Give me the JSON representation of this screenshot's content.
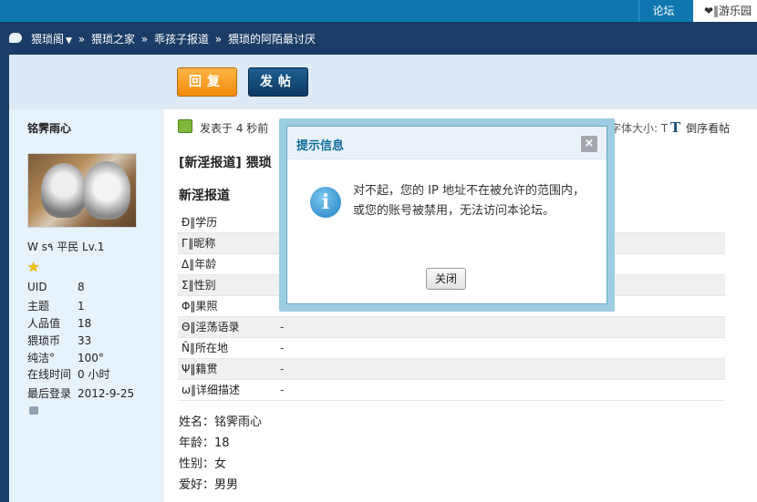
{
  "topbar": {
    "tab_forum": "论坛",
    "tab_playground": "❤‖游乐园"
  },
  "breadcrumb": {
    "items": [
      "猥琐阁",
      "猥琐之家",
      "乖孩子报道",
      "猥琐的阿陌最讨厌"
    ],
    "separator": "»"
  },
  "toolbar": {
    "reply_label": "回复",
    "post_label": "发帖"
  },
  "author": {
    "name": "铭霁雨心",
    "level": "W s٩ 平民 Lv.1",
    "stats": [
      {
        "key": "UID",
        "value": "8"
      },
      {
        "key": "主题",
        "value": "1"
      },
      {
        "key": "人品值",
        "value": "18"
      },
      {
        "key": "猥琐币",
        "value": "33"
      },
      {
        "key": "纯洁°",
        "value": "100°"
      },
      {
        "key": "在线时间",
        "value": "0 小时"
      },
      {
        "key": "最后登录",
        "value": "2012-9-25"
      }
    ]
  },
  "post": {
    "time": "发表于 4 秒前",
    "font_size_label": "字体大小:",
    "font_size_t": "T",
    "reverse_icon": "T",
    "reverse_label": "倒序看帖",
    "title": "[新淫报道] 猥琐",
    "section_heading": "新淫报道",
    "fields": [
      {
        "label": "Ð‖学历",
        "value": ""
      },
      {
        "label": "Г‖昵称",
        "value": ""
      },
      {
        "label": "Δ‖年龄",
        "value": ""
      },
      {
        "label": "Σ‖性别",
        "value": ""
      },
      {
        "label": "Φ‖果照",
        "value": ""
      },
      {
        "label": "Θ‖淫荡语录",
        "value": "-"
      },
      {
        "label": "Ñ‖所在地",
        "value": "-"
      },
      {
        "label": "Ψ‖籍贯",
        "value": "-"
      },
      {
        "label": "ω‖详细描述",
        "value": "-"
      }
    ],
    "profile_lines": [
      "姓名：铭霁雨心",
      "年龄：18",
      "性别：女",
      "爱好：男男"
    ]
  },
  "modal": {
    "title": "提示信息",
    "message": "对不起，您的 IP 地址不在被允许的范围内，或您的账号被禁用，无法访问本论坛。",
    "close_label": "关闭",
    "close_icon": "×",
    "info_icon": "i"
  }
}
